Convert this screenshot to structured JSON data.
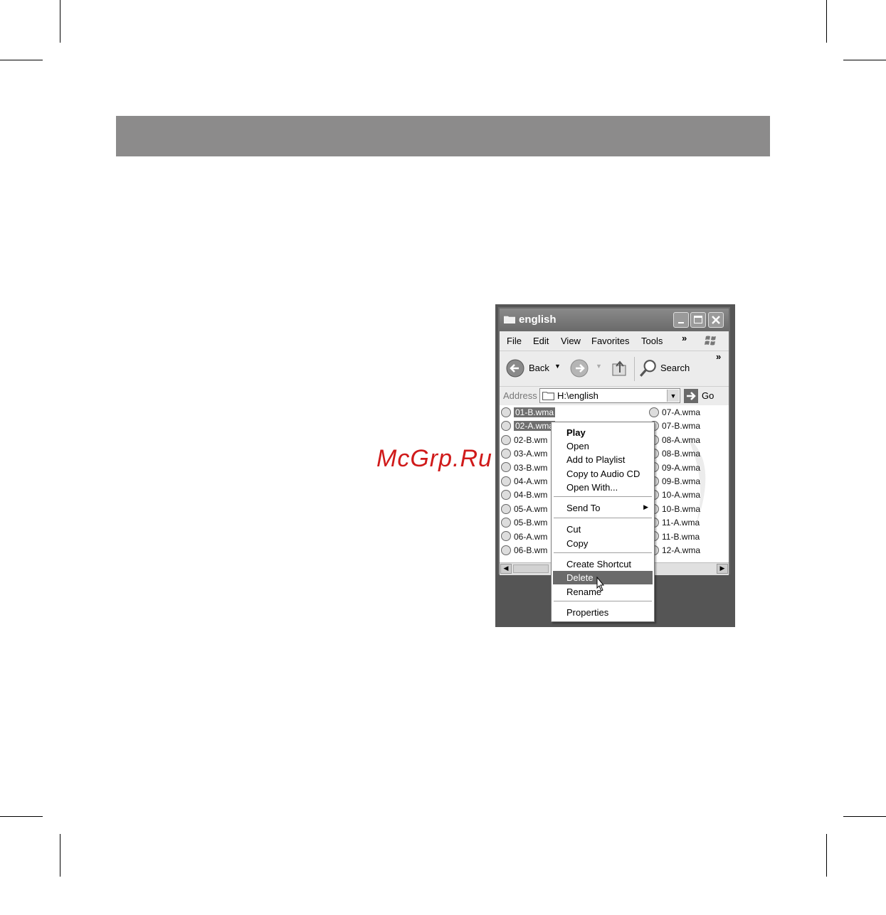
{
  "watermark": "McGrp.Ru",
  "window": {
    "title": "english",
    "menu": [
      "File",
      "Edit",
      "View",
      "Favorites",
      "Tools"
    ],
    "menu_more": "»",
    "toolbar": {
      "back": "Back",
      "search": "Search",
      "more": "»"
    },
    "address": {
      "label": "Address",
      "value": "H:\\english",
      "go": "Go"
    }
  },
  "files": {
    "left": [
      "01-B.wma",
      "02-A.wma",
      "02-B.wma",
      "03-A.wma",
      "03-B.wma",
      "04-A.wma",
      "04-B.wma",
      "05-A.wma",
      "05-B.wma",
      "06-A.wma",
      "06-B.wma"
    ],
    "left_visible": [
      "01-B.wma",
      "02-A.wma",
      "02-B.wm",
      "03-A.wm",
      "03-B.wm",
      "04-A.wm",
      "04-B.wm",
      "05-A.wm",
      "05-B.wm",
      "06-A.wm",
      "06-B.wm"
    ],
    "right": [
      "07-A.wma",
      "07-B.wma",
      "08-A.wma",
      "08-B.wma",
      "09-A.wma",
      "09-B.wma",
      "10-A.wma",
      "10-B.wma",
      "11-A.wma",
      "11-B.wma",
      "12-A.wma"
    ],
    "selected": [
      "01-B.wma",
      "02-A.wma"
    ]
  },
  "context_menu": {
    "items": [
      "Play",
      "Open",
      "Add to Playlist",
      "Copy to Audio CD",
      "Open With...",
      "Send To",
      "Cut",
      "Copy",
      "Create Shortcut",
      "Delete",
      "Rename",
      "Properties"
    ],
    "default_item": "Play",
    "highlighted_item": "Delete",
    "submenu_item": "Send To"
  },
  "colors": {
    "banner": "#8c8b8b",
    "highlight": "#6a6a6a",
    "watermark": "#d01a1a"
  }
}
